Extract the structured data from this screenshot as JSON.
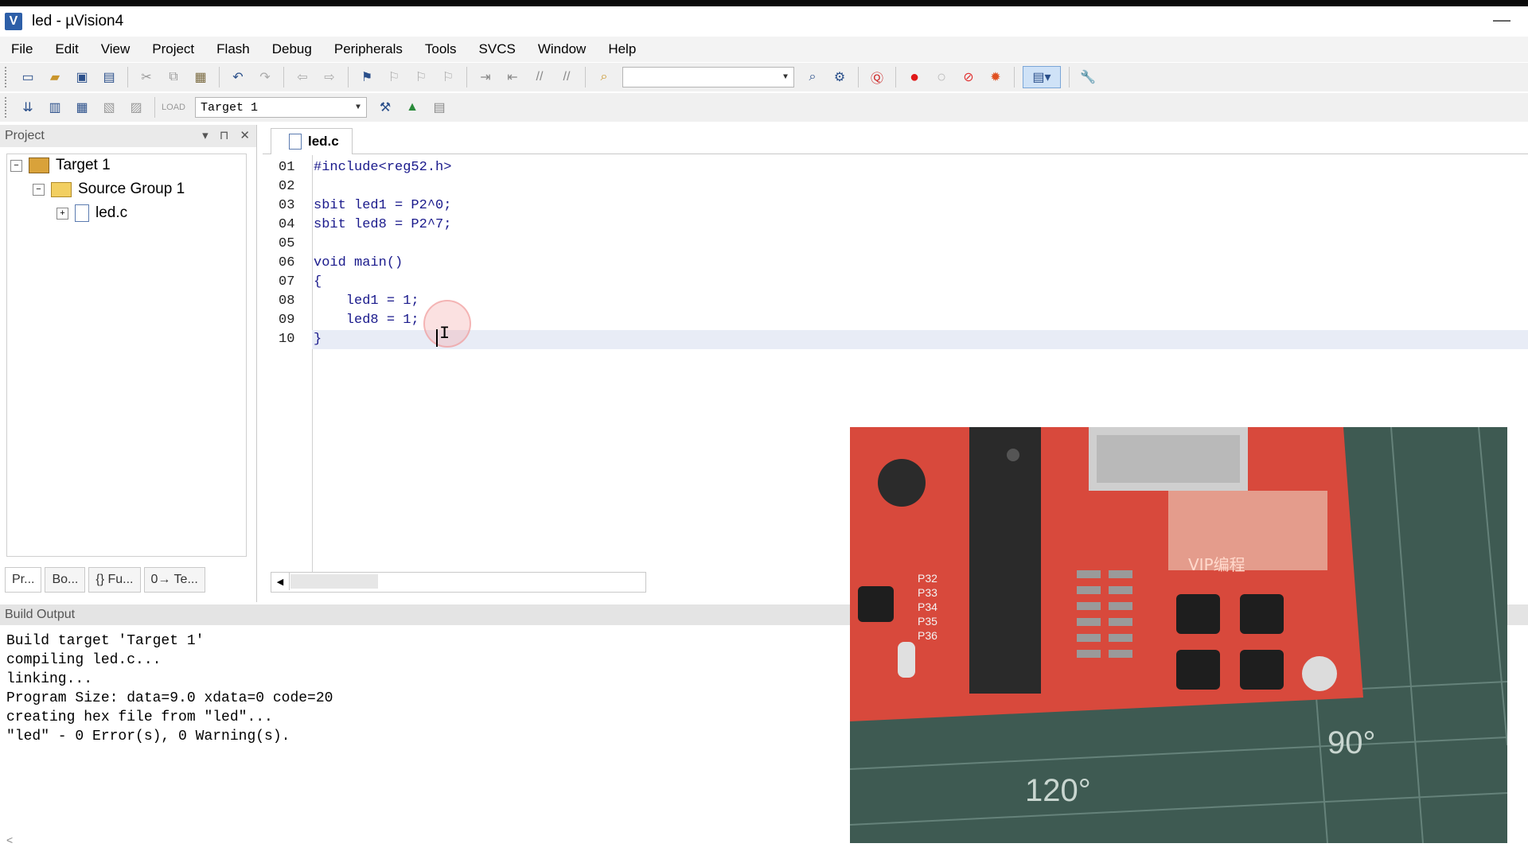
{
  "window": {
    "title": "led  - µVision4",
    "app_icon": "V"
  },
  "menu": [
    "File",
    "Edit",
    "View",
    "Project",
    "Flash",
    "Debug",
    "Peripherals",
    "Tools",
    "SVCS",
    "Window",
    "Help"
  ],
  "toolbar2": {
    "target_select": "Target 1"
  },
  "project_panel": {
    "title": "Project",
    "tree": {
      "target": "Target 1",
      "group": "Source Group 1",
      "file": "led.c"
    },
    "tabs": [
      "Pr...",
      "Bo...",
      "{} Fu...",
      "0→ Te..."
    ]
  },
  "editor": {
    "tab": "led.c",
    "line_numbers": [
      "01",
      "02",
      "03",
      "04",
      "05",
      "06",
      "07",
      "08",
      "09",
      "10"
    ],
    "lines": [
      "#include<reg52.h>",
      "",
      "sbit led1 = P2^0;",
      "sbit led8 = P2^7;",
      "",
      "void main()",
      "{",
      "    led1 = 1;",
      "    led8 = 1;",
      "}"
    ]
  },
  "build_output": {
    "title": "Build Output",
    "lines": [
      "Build target 'Target 1'",
      "compiling led.c...",
      "linking...",
      "Program Size: data=9.0 xdata=0 code=20",
      "creating hex file from \"led\"...",
      "\"led\" - 0 Error(s), 0 Warning(s)."
    ]
  },
  "overlay_photo": {
    "chip_labels": [
      "P32",
      "P33",
      "P34",
      "P35",
      "P36"
    ],
    "brand": "VIP编程",
    "mat_angles": [
      "90°",
      "120°"
    ]
  },
  "colors": {
    "code_text": "#1a1a8c",
    "current_line": "#e8ecf6",
    "pcb_red": "#d8493c",
    "mat_green": "#3e5a52"
  }
}
